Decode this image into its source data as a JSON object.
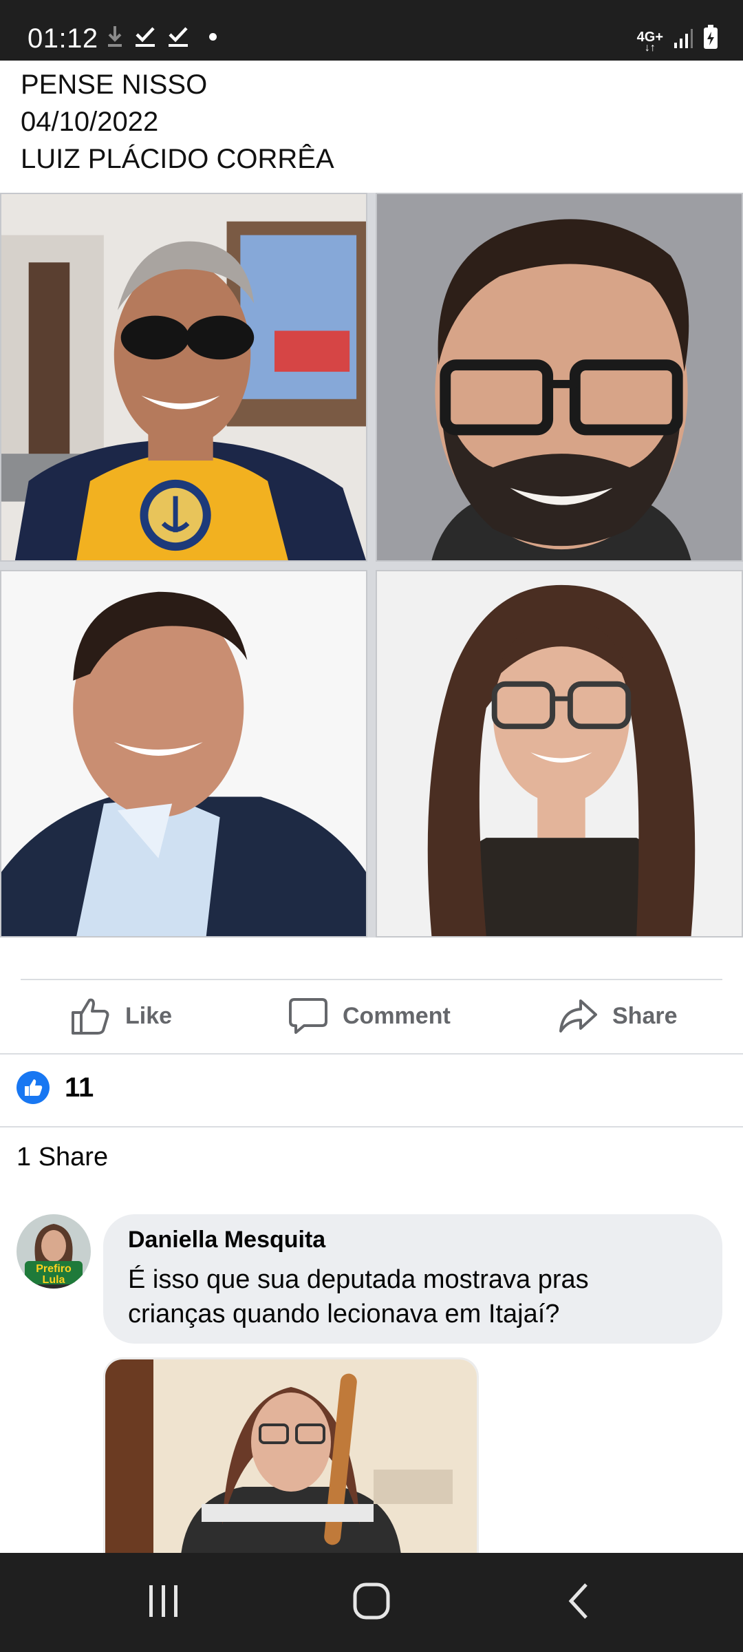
{
  "status_bar": {
    "time": "01:12",
    "network": "4G+",
    "icons": [
      "download-icon",
      "check-icon",
      "check-icon",
      "dot-icon",
      "signal-icon",
      "battery-icon"
    ]
  },
  "post": {
    "lines": [
      "PENSE NISSO",
      "04/10/2022",
      "LUIZ PLÁCIDO CORRÊA"
    ],
    "photos": [
      "photo-man-sunglasses",
      "photo-man-glasses-beard",
      "photo-man-suit",
      "photo-woman-glasses"
    ]
  },
  "actions": {
    "like": "Like",
    "comment": "Comment",
    "share": "Share"
  },
  "reactions": {
    "count": "11"
  },
  "shares": "1 Share",
  "comment": {
    "author": "Daniella Mesquita",
    "text": "É isso que sua deputada mostrava pras crianças quando lecionava em Itajaí?",
    "avatar_badge": "Prefiro Lula"
  },
  "colors": {
    "accent": "#1877f2",
    "action_text": "#65676b",
    "bubble": "#eceef1",
    "bars": "#1f1f1f"
  }
}
